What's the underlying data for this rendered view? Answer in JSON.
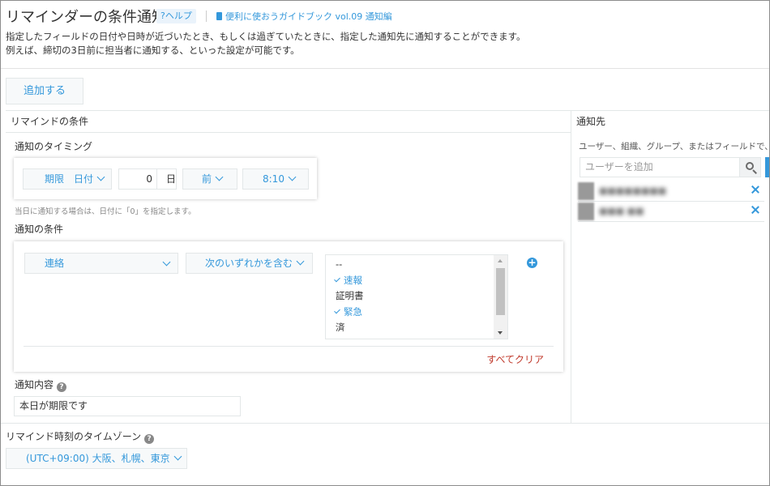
{
  "header": {
    "title": "リマインダーの条件通知",
    "help_label": "?ヘルプ",
    "guide_label": "便利に使おうガイドブック vol.09 通知編",
    "desc_line1": "指定したフィールドの日付や日時が近づいたとき、もしくは過ぎていたときに、指定した通知先に通知することができます。",
    "desc_line2": "例えば、締切の3日前に担当者に通知する、といった設定が可能です。"
  },
  "toolbar": {
    "add_label": "追加する"
  },
  "condition_panel": {
    "heading": "リマインドの条件",
    "timing": {
      "label": "通知のタイミング",
      "field": "期限　日付",
      "days_value": "0",
      "days_unit": "日",
      "direction": "前",
      "time": "8:10",
      "hint": "当日に通知する場合は、日付に「0」を指定します。"
    },
    "condition": {
      "label": "通知の条件",
      "field": "連絡",
      "operator": "次のいずれかを含む",
      "options": [
        {
          "label": "--",
          "selected": false
        },
        {
          "label": "速報",
          "selected": true
        },
        {
          "label": "証明書",
          "selected": false
        },
        {
          "label": "緊急",
          "selected": true
        },
        {
          "label": "済",
          "selected": false
        }
      ],
      "clear_all": "すべてクリア"
    },
    "content": {
      "label": "通知内容",
      "value": "本日が期限です"
    }
  },
  "recipient_panel": {
    "heading": "通知先",
    "desc": "ユーザー、組織、グループ、またはフィールドで、通知",
    "search_placeholder": "ユーザーを追加",
    "users": [
      {
        "name": "■■■■■■■■"
      },
      {
        "name": "■■■ ■■"
      }
    ]
  },
  "timezone": {
    "label": "リマインド時刻のタイムゾーン",
    "value": "(UTC+09:00) 大阪、札幌、東京"
  },
  "colors": {
    "accent": "#3498db",
    "clear": "#c0392b"
  }
}
